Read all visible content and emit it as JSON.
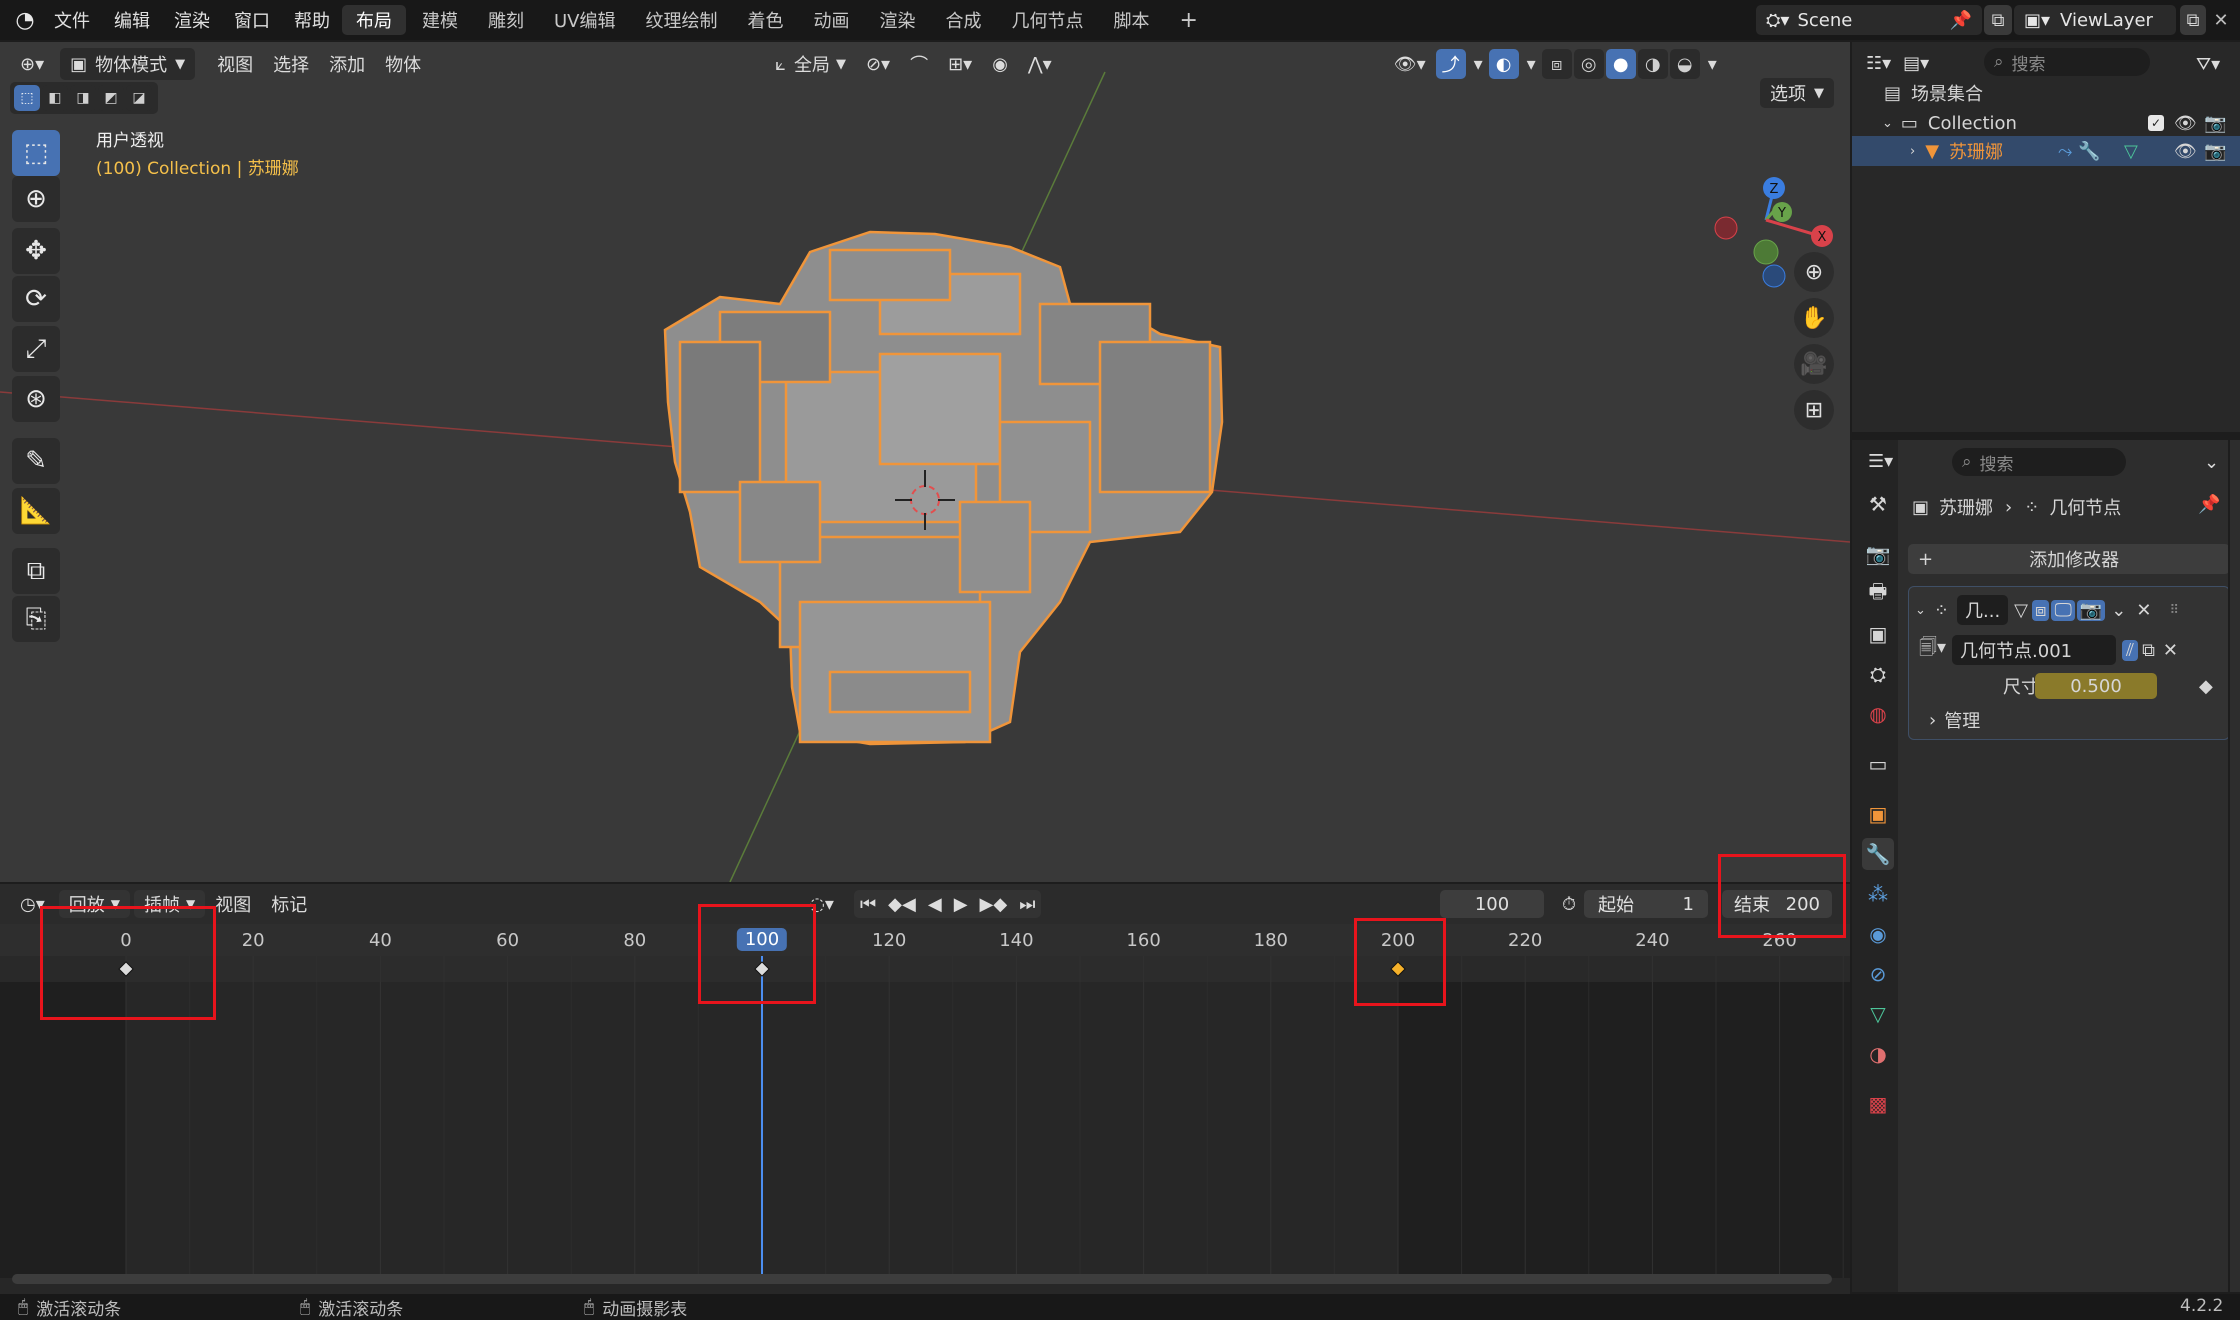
{
  "topbar": {
    "menu": [
      "文件",
      "编辑",
      "渲染",
      "窗口",
      "帮助"
    ],
    "workspaces": [
      "布局",
      "建模",
      "雕刻",
      "UV编辑",
      "纹理绘制",
      "着色",
      "动画",
      "渲染",
      "合成",
      "几何节点",
      "脚本"
    ],
    "add_tab": "+",
    "scene": "Scene",
    "view_layer": "ViewLayer"
  },
  "viewport": {
    "mode": "物体模式",
    "menus": [
      "视图",
      "选择",
      "添加",
      "物体"
    ],
    "transform_orientation": "全局",
    "options": "选项",
    "view_name": "用户透视",
    "collection_info": "(100) Collection | 苏珊娜",
    "gizmo_labels": {
      "z": "Z",
      "y": "Y",
      "x": "X"
    }
  },
  "timeline": {
    "menus": [
      "回放",
      "插帧",
      "视图",
      "标记"
    ],
    "current_frame": "100",
    "start_label": "起始",
    "start_value": "1",
    "end_label": "结束",
    "end_value": "200",
    "ticks": [
      "0",
      "20",
      "40",
      "60",
      "80",
      "100",
      "120",
      "140",
      "160",
      "180",
      "200",
      "220",
      "240",
      "260"
    ],
    "tick_values": [
      0,
      20,
      40,
      60,
      80,
      100,
      120,
      140,
      160,
      180,
      200,
      220,
      240,
      260
    ],
    "keyframes": [
      0,
      100,
      200
    ]
  },
  "outliner": {
    "search_placeholder": "搜索",
    "scene_collection": "场景集合",
    "collection": "Collection",
    "object": "苏珊娜"
  },
  "properties": {
    "search_placeholder": "搜索",
    "breadcrumb_object": "苏珊娜",
    "breadcrumb_modifier": "几何节点",
    "add_modifier": "添加修改器",
    "modifier_name": "几...",
    "node_group": "几何节点.001",
    "size_label": "尺寸",
    "size_value": "0.500",
    "manage_label": "管理"
  },
  "statusbar": {
    "items": [
      "激活滚动条",
      "激活滚动条",
      "动画摄影表"
    ],
    "version": "4.2.2"
  },
  "colors": {
    "accent": "#4772b3",
    "selection_orange": "#f0953a",
    "highlight_red": "#e8141c",
    "keyframe_yellow": "#f5b12a"
  }
}
